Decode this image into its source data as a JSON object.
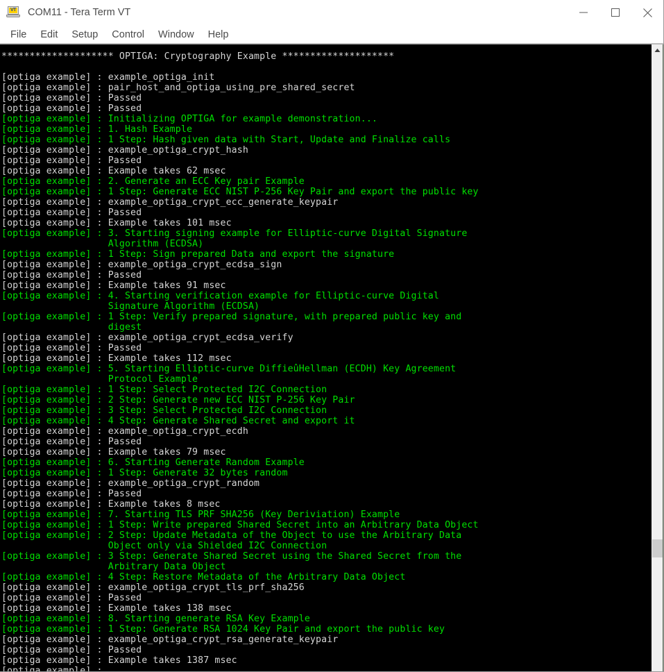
{
  "window": {
    "title": "COM11 - Tera Term VT",
    "icon": "teraterm-vt-icon",
    "icon_label": "VT",
    "controls": {
      "minimize": "minimize-icon",
      "maximize": "maximize-icon",
      "close": "close-icon"
    }
  },
  "menubar": {
    "items": [
      "File",
      "Edit",
      "Setup",
      "Control",
      "Window",
      "Help"
    ]
  },
  "colors": {
    "terminal_background": "#000000",
    "text_white": "#d6d6d6",
    "text_green": "#00e000",
    "window_chrome": "#ffffff",
    "scrollbar_track": "#f0f0f0",
    "scrollbar_thumb": "#cdcdcd"
  },
  "scrollbar": {
    "up_arrow": "scroll-up-arrow-icon",
    "thumb": "scrollbar-thumb"
  },
  "terminal": {
    "prefix": "[optiga example] : ",
    "indent": "                   ",
    "lines": [
      {
        "color": "white",
        "text": "******************** OPTIGA: Cryptography Example ********************"
      },
      {
        "color": "blank",
        "text": ""
      },
      {
        "color": "white",
        "text": "[optiga example] : example_optiga_init"
      },
      {
        "color": "white",
        "text": "[optiga example] : pair_host_and_optiga_using_pre_shared_secret"
      },
      {
        "color": "white",
        "text": "[optiga example] : Passed"
      },
      {
        "color": "white",
        "text": "[optiga example] : Passed"
      },
      {
        "color": "green",
        "text": "[optiga example] : Initializing OPTIGA for example demonstration..."
      },
      {
        "color": "green",
        "text": "[optiga example] : 1. Hash Example"
      },
      {
        "color": "green",
        "text": "[optiga example] : 1 Step: Hash given data with Start, Update and Finalize calls"
      },
      {
        "color": "white",
        "text": "[optiga example] : example_optiga_crypt_hash"
      },
      {
        "color": "white",
        "text": "[optiga example] : Passed"
      },
      {
        "color": "white",
        "text": "[optiga example] : Example takes 62 msec"
      },
      {
        "color": "green",
        "text": "[optiga example] : 2. Generate an ECC Key pair Example"
      },
      {
        "color": "green",
        "text": "[optiga example] : 1 Step: Generate ECC NIST P-256 Key Pair and export the public key"
      },
      {
        "color": "white",
        "text": "[optiga example] : example_optiga_crypt_ecc_generate_keypair"
      },
      {
        "color": "white",
        "text": "[optiga example] : Passed"
      },
      {
        "color": "white",
        "text": "[optiga example] : Example takes 101 msec"
      },
      {
        "color": "green",
        "text": "[optiga example] : 3. Starting signing example for Elliptic-curve Digital Signature"
      },
      {
        "color": "green",
        "text": "                   Algorithm (ECDSA)"
      },
      {
        "color": "green",
        "text": "[optiga example] : 1 Step: Sign prepared Data and export the signature"
      },
      {
        "color": "white",
        "text": "[optiga example] : example_optiga_crypt_ecdsa_sign"
      },
      {
        "color": "white",
        "text": "[optiga example] : Passed"
      },
      {
        "color": "white",
        "text": "[optiga example] : Example takes 91 msec"
      },
      {
        "color": "green",
        "text": "[optiga example] : 4. Starting verification example for Elliptic-curve Digital"
      },
      {
        "color": "green",
        "text": "                   Signature Algorithm (ECDSA)"
      },
      {
        "color": "green",
        "text": "[optiga example] : 1 Step: Verify prepared signature, with prepared public key and"
      },
      {
        "color": "green",
        "text": "                   digest"
      },
      {
        "color": "white",
        "text": "[optiga example] : example_optiga_crypt_ecdsa_verify"
      },
      {
        "color": "white",
        "text": "[optiga example] : Passed"
      },
      {
        "color": "white",
        "text": "[optiga example] : Example takes 112 msec"
      },
      {
        "color": "green",
        "text": "[optiga example] : 5. Starting Elliptic-curve DiffieûHellman (ECDH) Key Agreement"
      },
      {
        "color": "green",
        "text": "                   Protocol Example"
      },
      {
        "color": "green",
        "text": "[optiga example] : 1 Step: Select Protected I2C Connection"
      },
      {
        "color": "green",
        "text": "[optiga example] : 2 Step: Generate new ECC NIST P-256 Key Pair"
      },
      {
        "color": "green",
        "text": "[optiga example] : 3 Step: Select Protected I2C Connection"
      },
      {
        "color": "green",
        "text": "[optiga example] : 4 Step: Generate Shared Secret and export it"
      },
      {
        "color": "white",
        "text": "[optiga example] : example_optiga_crypt_ecdh"
      },
      {
        "color": "white",
        "text": "[optiga example] : Passed"
      },
      {
        "color": "white",
        "text": "[optiga example] : Example takes 79 msec"
      },
      {
        "color": "green",
        "text": "[optiga example] : 6. Starting Generate Random Example"
      },
      {
        "color": "green",
        "text": "[optiga example] : 1 Step: Generate 32 bytes random"
      },
      {
        "color": "white",
        "text": "[optiga example] : example_optiga_crypt_random"
      },
      {
        "color": "white",
        "text": "[optiga example] : Passed"
      },
      {
        "color": "white",
        "text": "[optiga example] : Example takes 8 msec"
      },
      {
        "color": "green",
        "text": "[optiga example] : 7. Starting TLS PRF SHA256 (Key Deriviation) Example"
      },
      {
        "color": "green",
        "text": "[optiga example] : 1 Step: Write prepared Shared Secret into an Arbitrary Data Object"
      },
      {
        "color": "green",
        "text": "[optiga example] : 2 Step: Update Metadata of the Object to use the Arbitrary Data"
      },
      {
        "color": "green",
        "text": "                   Object only via Shielded I2C Connection"
      },
      {
        "color": "green",
        "text": "[optiga example] : 3 Step: Generate Shared Secret using the Shared Secret from the"
      },
      {
        "color": "green",
        "text": "                   Arbitrary Data Object"
      },
      {
        "color": "green",
        "text": "[optiga example] : 4 Step: Restore Metadata of the Arbitrary Data Object"
      },
      {
        "color": "white",
        "text": "[optiga example] : example_optiga_crypt_tls_prf_sha256"
      },
      {
        "color": "white",
        "text": "[optiga example] : Passed"
      },
      {
        "color": "white",
        "text": "[optiga example] : Example takes 138 msec"
      },
      {
        "color": "green",
        "text": "[optiga example] : 8. Starting generate RSA Key Example"
      },
      {
        "color": "green",
        "text": "[optiga example] : 1 Step: Generate RSA 1024 Key Pair and export the public key"
      },
      {
        "color": "white",
        "text": "[optiga example] : example_optiga_crypt_rsa_generate_keypair"
      },
      {
        "color": "white",
        "text": "[optiga example] : Passed"
      },
      {
        "color": "white",
        "text": "[optiga example] : Example takes 1387 msec"
      },
      {
        "color": "white",
        "text": "[optiga example] :"
      }
    ]
  }
}
